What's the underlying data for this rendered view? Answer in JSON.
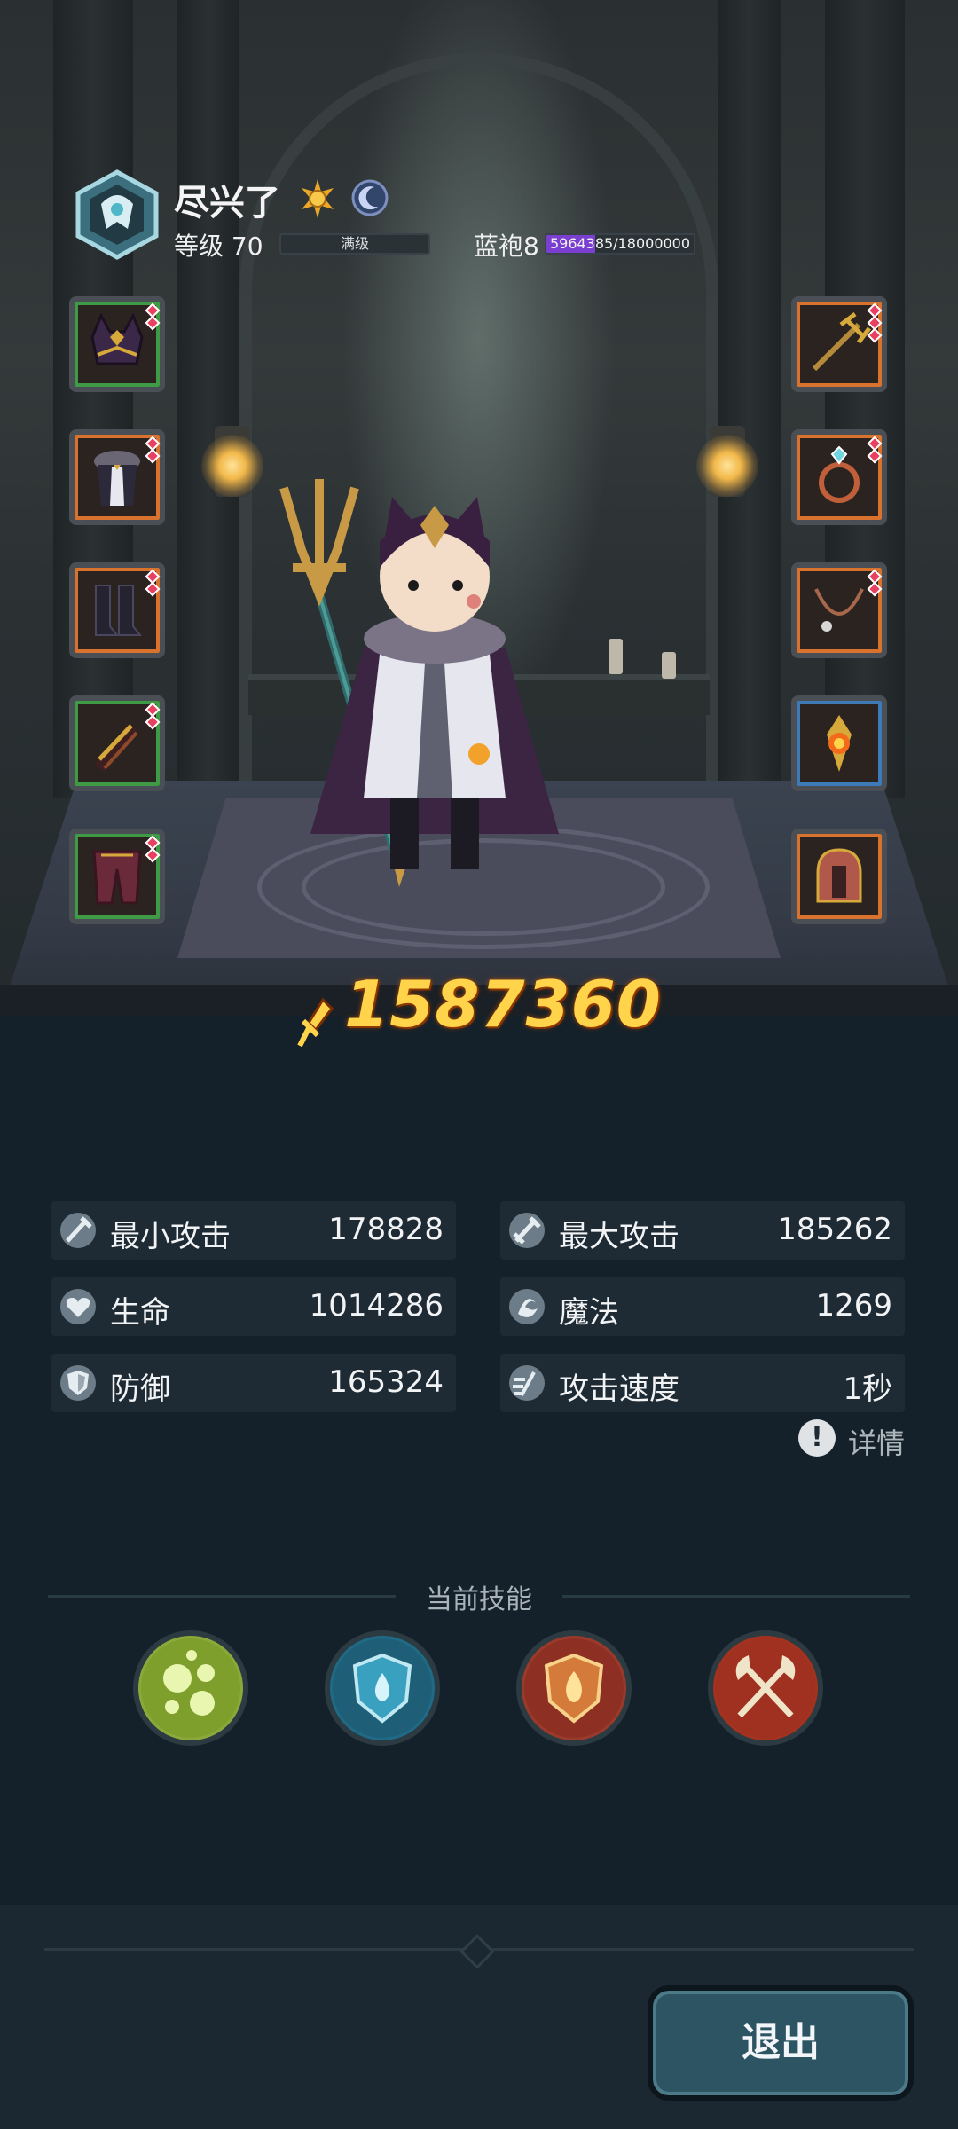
{
  "player": {
    "name": "尽兴了",
    "level_label": "等级 70",
    "level_bar_text": "满级",
    "rank_label": "蓝袍8",
    "rank_progress_text": "5964385/18000000",
    "rank_progress_fraction": 0.331
  },
  "equipment": {
    "left": [
      "cat-hood-icon",
      "fur-robe-icon",
      "boots-icon",
      "bracer-icon",
      "leg-armor-icon"
    ],
    "right": [
      "trident-staff-icon",
      "ring-icon",
      "necklace-icon",
      "flame-amulet-icon",
      "helmet-icon"
    ]
  },
  "power": {
    "value": "1587360"
  },
  "stats": [
    {
      "label": "最小攻击",
      "value": "178828",
      "icon": "min-attack-icon"
    },
    {
      "label": "最大攻击",
      "value": "185262",
      "icon": "max-attack-icon"
    },
    {
      "label": "生命",
      "value": "1014286",
      "icon": "health-icon"
    },
    {
      "label": "魔法",
      "value": "1269",
      "icon": "magic-icon"
    },
    {
      "label": "防御",
      "value": "165324",
      "icon": "defense-icon"
    },
    {
      "label": "攻击速度",
      "value": "1秒",
      "icon": "attack-speed-icon"
    }
  ],
  "details_label": "详情",
  "skills_title": "当前技能",
  "skills": [
    "poison-bubbles-skill-icon",
    "water-shield-skill-icon",
    "fire-shield-skill-icon",
    "crossed-axes-skill-icon"
  ],
  "exit_label": "退出"
}
